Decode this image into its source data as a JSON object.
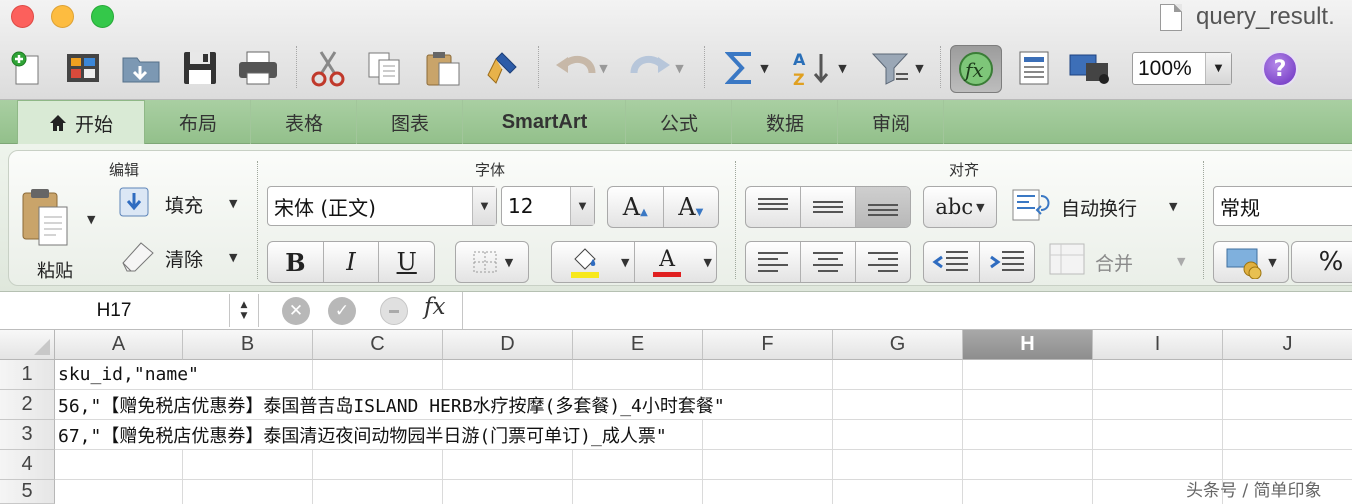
{
  "window": {
    "title": "query_result.",
    "buttons": [
      "close",
      "minimize",
      "maximize"
    ]
  },
  "toolbar": {
    "icons": [
      "new-icon",
      "templates-icon",
      "open-icon",
      "save-icon",
      "print-icon",
      "cut-icon",
      "copy-icon",
      "paste-icon",
      "format-painter-icon",
      "undo-icon",
      "redo-icon",
      "autosum-icon",
      "sort-icon",
      "filter-icon",
      "formula-builder-icon",
      "toolbox-icon",
      "media-browser-icon",
      "help-icon"
    ],
    "zoom": "100%"
  },
  "tabs": [
    "开始",
    "布局",
    "表格",
    "图表",
    "SmartArt",
    "公式",
    "数据",
    "审阅"
  ],
  "ribbon": {
    "edit": {
      "title": "编辑",
      "paste": "粘贴",
      "fill": "填充",
      "clear": "清除"
    },
    "font": {
      "title": "字体",
      "name": "宋体 (正文)",
      "size": "12",
      "bold": "B",
      "italic": "I",
      "underline": "U",
      "grow": "A",
      "shrink": "A",
      "font_color": "A",
      "highlight_color": "#f7e81c",
      "font_color_hex": "#e02020"
    },
    "align": {
      "title": "对齐",
      "orientation": "abc",
      "wrap": "自动换行",
      "merge": "合并"
    },
    "number": {
      "format": "常规",
      "percent": "%"
    }
  },
  "formula_bar": {
    "name_box": "H17",
    "fx": "fx",
    "content": ""
  },
  "sheet": {
    "columns": [
      "A",
      "B",
      "C",
      "D",
      "E",
      "F",
      "G",
      "H",
      "I",
      "J"
    ],
    "selected_column": "H",
    "rows": [
      "1",
      "2",
      "3",
      "4",
      "5"
    ],
    "cells": [
      "sku_id,\"name\"",
      "56,\"【赠免税店优惠券】泰国普吉岛ISLAND HERB水疗按摩(多套餐)_4小时套餐\"",
      "67,\"【赠免税店优惠券】泰国清迈夜间动物园半日游(门票可单订)_成人票\""
    ]
  },
  "watermark": "头条号 / 简单印象"
}
